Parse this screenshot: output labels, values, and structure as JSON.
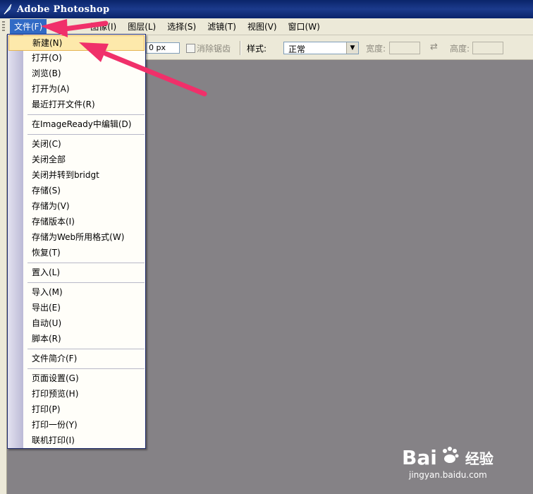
{
  "window": {
    "title": "Adobe Photoshop"
  },
  "menubar": {
    "items": [
      {
        "label": "文件(F)"
      },
      {
        "label": "图像(I)"
      },
      {
        "label": "图层(L)"
      },
      {
        "label": "选择(S)"
      },
      {
        "label": "滤镜(T)"
      },
      {
        "label": "视图(V)"
      },
      {
        "label": "窗口(W)"
      }
    ]
  },
  "options": {
    "feather_value": "0 px",
    "antialias_label": "消除锯齿",
    "style_label": "样式:",
    "style_value": "正常",
    "width_label": "宽度:",
    "height_label": "高度:"
  },
  "file_menu": {
    "items": [
      "新建(N)",
      "打开(O)",
      "浏览(B)",
      "打开为(A)",
      "最近打开文件(R)",
      "在ImageReady中编辑(D)",
      "关闭(C)",
      "关闭全部",
      "关闭并转到bridgt",
      "存储(S)",
      "存储为(V)",
      "存储版本(I)",
      "存储为Web所用格式(W)",
      "恢复(T)",
      "置入(L)",
      "导入(M)",
      "导出(E)",
      "自动(U)",
      "脚本(R)",
      "文件简介(F)",
      "页面设置(G)",
      "打印预览(H)",
      "打印(P)",
      "打印一份(Y)",
      "联机打印(I)"
    ]
  },
  "watermark": {
    "brand_left": "Bai",
    "brand_right": "经验",
    "url": "jingyan.baidu.com"
  },
  "colors": {
    "titlebar": "#0a246a",
    "menu_highlight": "#fde9ab",
    "arrow": "#f0306a",
    "workspace": "#858286"
  }
}
